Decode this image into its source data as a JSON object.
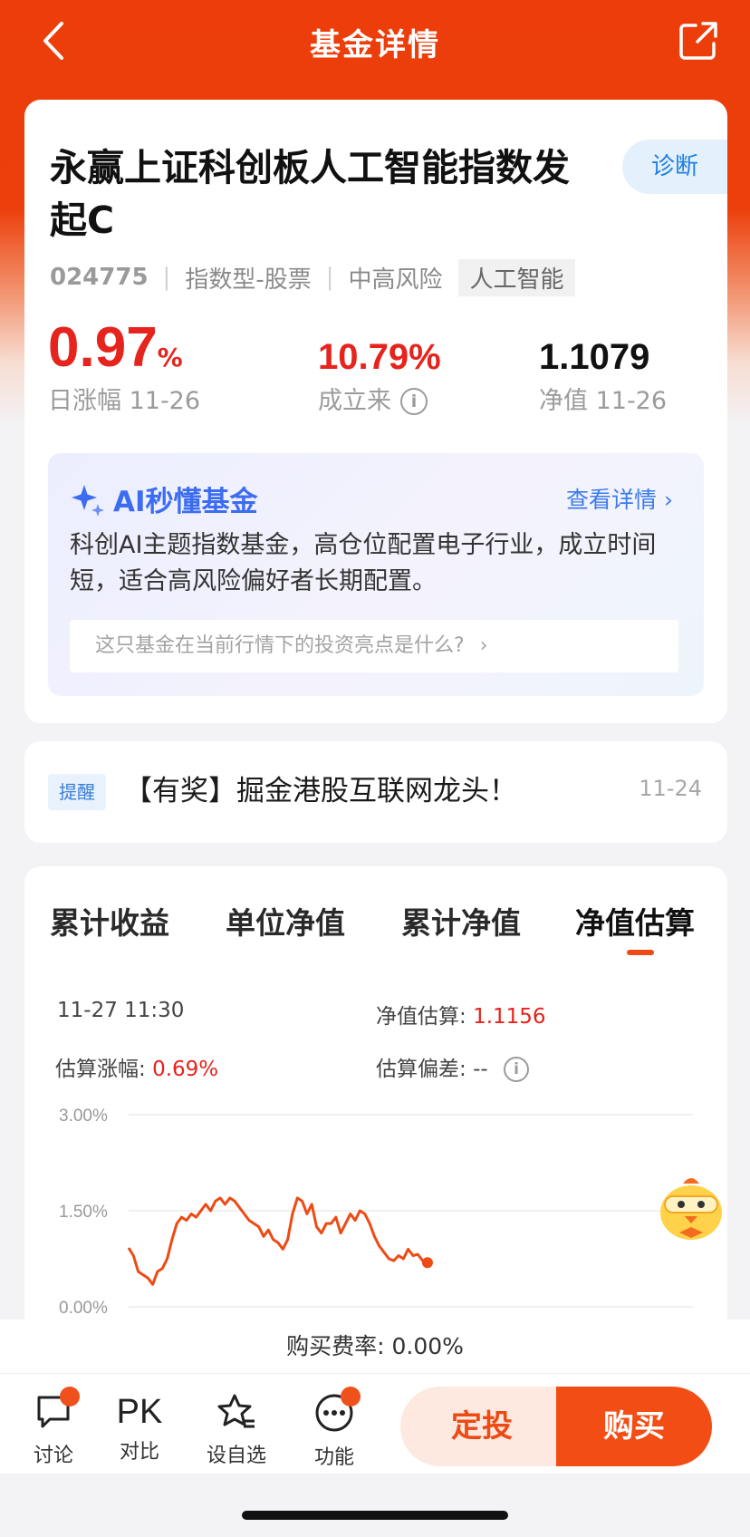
{
  "nav": {
    "title": "基金详情"
  },
  "fund": {
    "name": "永赢上证科创板人工智能指数发起C",
    "diagnose": "诊断",
    "code": "024775",
    "type": "指数型-股票",
    "risk": "中高风险",
    "theme_tag": "人工智能",
    "day_change_value": "0.97",
    "day_change_unit": "%",
    "day_change_label": "日涨幅 11-26",
    "since_inception_value": "10.79%",
    "since_inception_label": "成立来",
    "nav_value": "1.1079",
    "nav_label": "净值 11-26"
  },
  "ai": {
    "title": "AI秒懂基金",
    "more": "查看详情",
    "summary": "科创AI主题指数基金，高仓位配置电子行业，成立时间短，适合高风险偏好者长期配置。",
    "question": "这只基金在当前行情下的投资亮点是什么?"
  },
  "notice": {
    "tag": "提醒",
    "text": "【有奖】掘金港股互联网龙头！",
    "date": "11-24"
  },
  "tabs": [
    "累计收益",
    "单位净值",
    "累计净值",
    "净值估算"
  ],
  "estimate": {
    "time": "11-27 11:30",
    "nav_est_label": "净值估算:",
    "nav_est_value": "1.1156",
    "change_label": "估算涨幅:",
    "change_value": "0.69%",
    "deviation_label": "估算偏差:",
    "deviation_value": "--"
  },
  "chart_data": {
    "type": "line",
    "yticks": [
      "3.00%",
      "1.50%",
      "0.00%"
    ],
    "ylim": [
      0,
      3
    ],
    "x": [
      0,
      1,
      2,
      3,
      4,
      5,
      6,
      7,
      8,
      9,
      10,
      11,
      12,
      13,
      14,
      15,
      16,
      17,
      18,
      19,
      20,
      21,
      22,
      23,
      24,
      25,
      26,
      27,
      28,
      29,
      30,
      31,
      32,
      33,
      34,
      35,
      36,
      37,
      38,
      39,
      40,
      41,
      42,
      43,
      44,
      45,
      46,
      47,
      48,
      49,
      50,
      51,
      52,
      53,
      54,
      55,
      56,
      57,
      58,
      59,
      60,
      61,
      62,
      63,
      64,
      65,
      66,
      67,
      68,
      69,
      70,
      71,
      72
    ],
    "values": [
      0.92,
      0.8,
      0.55,
      0.5,
      0.45,
      0.35,
      0.55,
      0.6,
      0.75,
      1.05,
      1.3,
      1.4,
      1.35,
      1.45,
      1.4,
      1.5,
      1.6,
      1.5,
      1.65,
      1.7,
      1.6,
      1.7,
      1.65,
      1.55,
      1.45,
      1.35,
      1.3,
      1.25,
      1.1,
      1.2,
      1.05,
      1.0,
      0.9,
      1.05,
      1.45,
      1.7,
      1.65,
      1.45,
      1.6,
      1.25,
      1.15,
      1.3,
      1.3,
      1.4,
      1.15,
      1.3,
      1.45,
      1.35,
      1.5,
      1.45,
      1.3,
      1.1,
      0.95,
      0.85,
      0.75,
      0.72,
      0.8,
      0.75,
      0.9,
      0.8,
      0.82,
      0.72,
      0.69
    ],
    "series_color": "#ee4a14"
  },
  "fee": {
    "label": "购买费率: 0.00%"
  },
  "bottom": {
    "discuss": "讨论",
    "compare_icon": "PK",
    "compare": "对比",
    "watch": "设自选",
    "more": "功能",
    "dingtou": "定投",
    "buy": "购买"
  }
}
